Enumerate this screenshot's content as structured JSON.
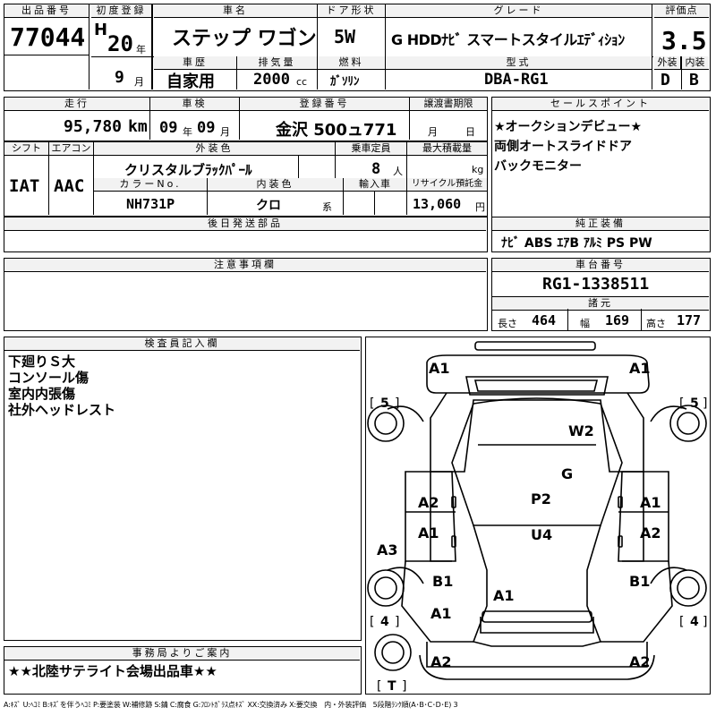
{
  "header": {
    "lot_label": "出品番号",
    "lot_value": "77044",
    "first_reg_label": "初度登録",
    "era": "H",
    "year_value": "20",
    "year_unit": "年",
    "history_label": "車歴",
    "month_value": "9",
    "month_unit": "月",
    "name_label": "車名",
    "name_value": "ステップ ワゴン",
    "history_value": "自家用",
    "displacement_label": "排気量",
    "displacement_value": "2000",
    "displacement_unit": "cc",
    "door_label": "ドア形状",
    "door_value": "5W",
    "fuel_label": "燃料",
    "fuel_value": "ｶﾞｿﾘﾝ",
    "grade_label": "グレード",
    "grade_value": "G HDDﾅﾋﾞ スマートスタイルｴﾃﾞｨｼｮﾝ",
    "model_label": "型式",
    "model_value": "DBA-RG1",
    "score_label": "評価点",
    "score_value": "3.5",
    "exterior_label": "外装",
    "exterior_value": "D",
    "interior_label": "内装",
    "interior_value": "B"
  },
  "row2": {
    "mileage_label": "走行",
    "mileage_value": "95,780",
    "mileage_unit": "km",
    "inspection_label": "車検",
    "insp_year": "09",
    "insp_year_unit": "年",
    "insp_month": "09",
    "insp_month_unit": "月",
    "plate_label": "登録番号",
    "plate_value": "金沢 500ュ771",
    "transfer_label": "譲渡書期限",
    "transfer_month": "月",
    "transfer_day": "日",
    "sales_label": "セールスポイント",
    "sales_points": [
      "★オークションデビュー★",
      "両側オートスライドドア",
      "バックモニター"
    ]
  },
  "row3": {
    "shift_label": "シフト",
    "shift_value": "IAT",
    "ac_label": "エアコン",
    "ac_value": "AAC",
    "color_label": "外装色",
    "color_value": "クリスタルブﾗｯｸﾊﾟｰﾙ",
    "capacity_label": "乗車定員",
    "capacity_value": "8",
    "capacity_unit": "人",
    "load_label": "最大積載量",
    "load_unit": "kg",
    "color_no_label": "カラーNo.",
    "color_no_value": "NH731P",
    "interior_color_label": "内装色",
    "interior_color_value": "クロ",
    "interior_color_unit": "系",
    "import_label": "輸入車",
    "recycle_label": "リサイクル預託金",
    "recycle_value": "13,060",
    "recycle_unit": "円"
  },
  "later_parts_label": "後日発送部品",
  "equipment": {
    "label": "純正装備",
    "value": "ﾅﾋﾞ ABS ｴｱB ｱﾙﾐ PS PW"
  },
  "caution_label": "注意事項欄",
  "chassis": {
    "label": "車台番号",
    "value": "RG1-1338511"
  },
  "dims": {
    "label": "諸元",
    "length_label": "長さ",
    "length_value": "464",
    "width_label": "幅",
    "width_value": "169",
    "height_label": "高さ",
    "height_value": "177"
  },
  "inspector": {
    "label": "検査員記入欄",
    "notes": [
      "下廻りＳ大",
      "コンソール傷",
      "室内内張傷",
      "社外ヘッドレスト"
    ]
  },
  "office": {
    "label": "事務局よりご案内",
    "value": "★★北陸サテライト会場出品車★★"
  },
  "legend": "A:ｷｽﾞ U:ﾍｺﾐ B:ｷｽﾞを伴うﾍｺﾐ P:要塗装 W:補修跡 S:錆 C:腐食 G:ﾌﾛﾝﾄｶﾞﾗｽ点ｷｽﾞ XX:交換済み X:要交換　内・外装評価　5段階ﾗﾝｸ順(A･B･C･D･E) 3",
  "diagram": {
    "marks": {
      "m1": "A1",
      "m2": "A1",
      "m3": "W2",
      "m4": "G",
      "m5": "A2",
      "m6": "A1",
      "m7": "P2",
      "m8": "A1",
      "m9": "A2",
      "m10": "U4",
      "m11": "A3",
      "m12": "B1",
      "m13": "B1",
      "m14": "A1",
      "m15": "A1",
      "m16": "A2",
      "m17": "A2"
    },
    "tire_labels": {
      "fl": "5",
      "fr": "5",
      "rl": "4",
      "rr": "4",
      "spare": "T"
    }
  }
}
